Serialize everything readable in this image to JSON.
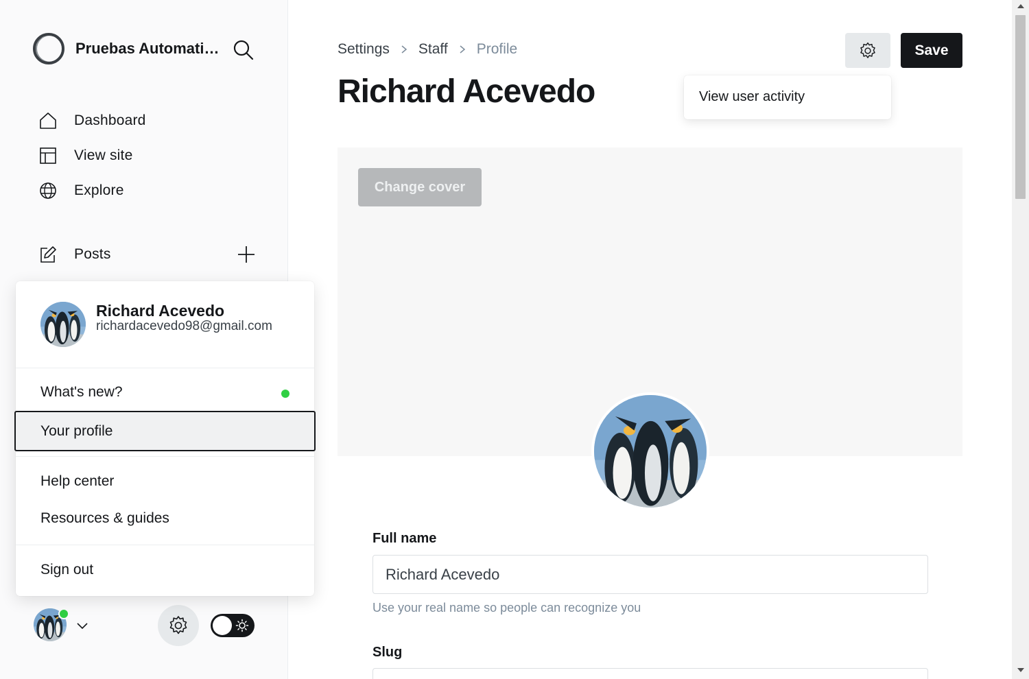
{
  "sidebar": {
    "site_name": "Pruebas Automatizadas",
    "nav": [
      {
        "label": "Dashboard",
        "icon": "home-icon"
      },
      {
        "label": "View site",
        "icon": "layout-icon"
      },
      {
        "label": "Explore",
        "icon": "globe-icon"
      }
    ],
    "posts_label": "Posts"
  },
  "account_menu": {
    "name": "Richard Acevedo",
    "email": "richardacevedo98@gmail.com",
    "items": {
      "whats_new": "What's new?",
      "your_profile": "Your profile",
      "help_center": "Help center",
      "resources": "Resources & guides",
      "sign_out": "Sign out"
    }
  },
  "header": {
    "breadcrumb": [
      "Settings",
      "Staff",
      "Profile"
    ],
    "title": "Richard Acevedo",
    "save_label": "Save",
    "activity_label": "View user activity"
  },
  "profile": {
    "change_cover_label": "Change cover",
    "full_name_label": "Full name",
    "full_name_value": "Richard Acevedo",
    "full_name_help": "Use your real name so people can recognize you",
    "slug_label": "Slug"
  },
  "colors": {
    "accent": "#15171a",
    "online": "#30cf43",
    "muted": "#7c8b9a"
  }
}
